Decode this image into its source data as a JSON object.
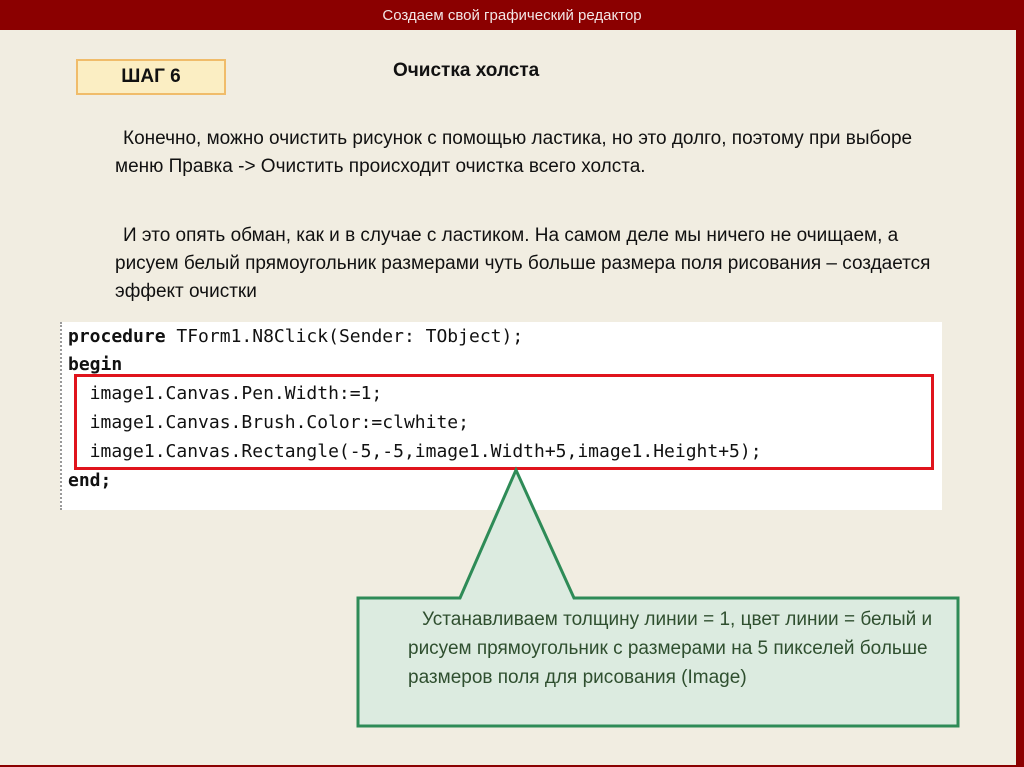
{
  "header": {
    "title": "Создаем свой графический редактор"
  },
  "step": {
    "label": "ШАГ 6"
  },
  "page": {
    "title": "Очистка холста"
  },
  "paragraphs": [
    "Конечно, можно очистить рисунок с помощью ластика, но это долго, поэтому при выборе меню Правка -> Очистить происходит очистка всего холста.",
    "И это опять обман, как и в случае с ластиком. На самом деле мы ничего не очищаем, а рисуем белый прямоугольник размерами чуть больше размера поля рисования – создается эффект очистки"
  ],
  "code": {
    "line1_kw": "procedure",
    "line1_rest": " TForm1.N8Click(Sender: TObject);",
    "line2_kw": "begin",
    "line3": "  image1.Canvas.Pen.Width:=1;",
    "line4": "  image1.Canvas.Brush.Color:=clwhite;",
    "line5": "  image1.Canvas.Rectangle(-5,-5,image1.Width+5,image1.Height+5);",
    "line6_kw": "end;"
  },
  "callout": {
    "text": "Устанавливаем толщину линии = 1, цвет линии = белый и рисуем прямоугольник с размерами на 5 пикселей больше размеров поля для рисования (Image)"
  },
  "colors": {
    "header_bg": "#8b0000",
    "badge_bg": "#fbeec3",
    "highlight": "#e0141c",
    "callout_fill": "#dcebe0",
    "callout_border": "#2e8b57"
  }
}
